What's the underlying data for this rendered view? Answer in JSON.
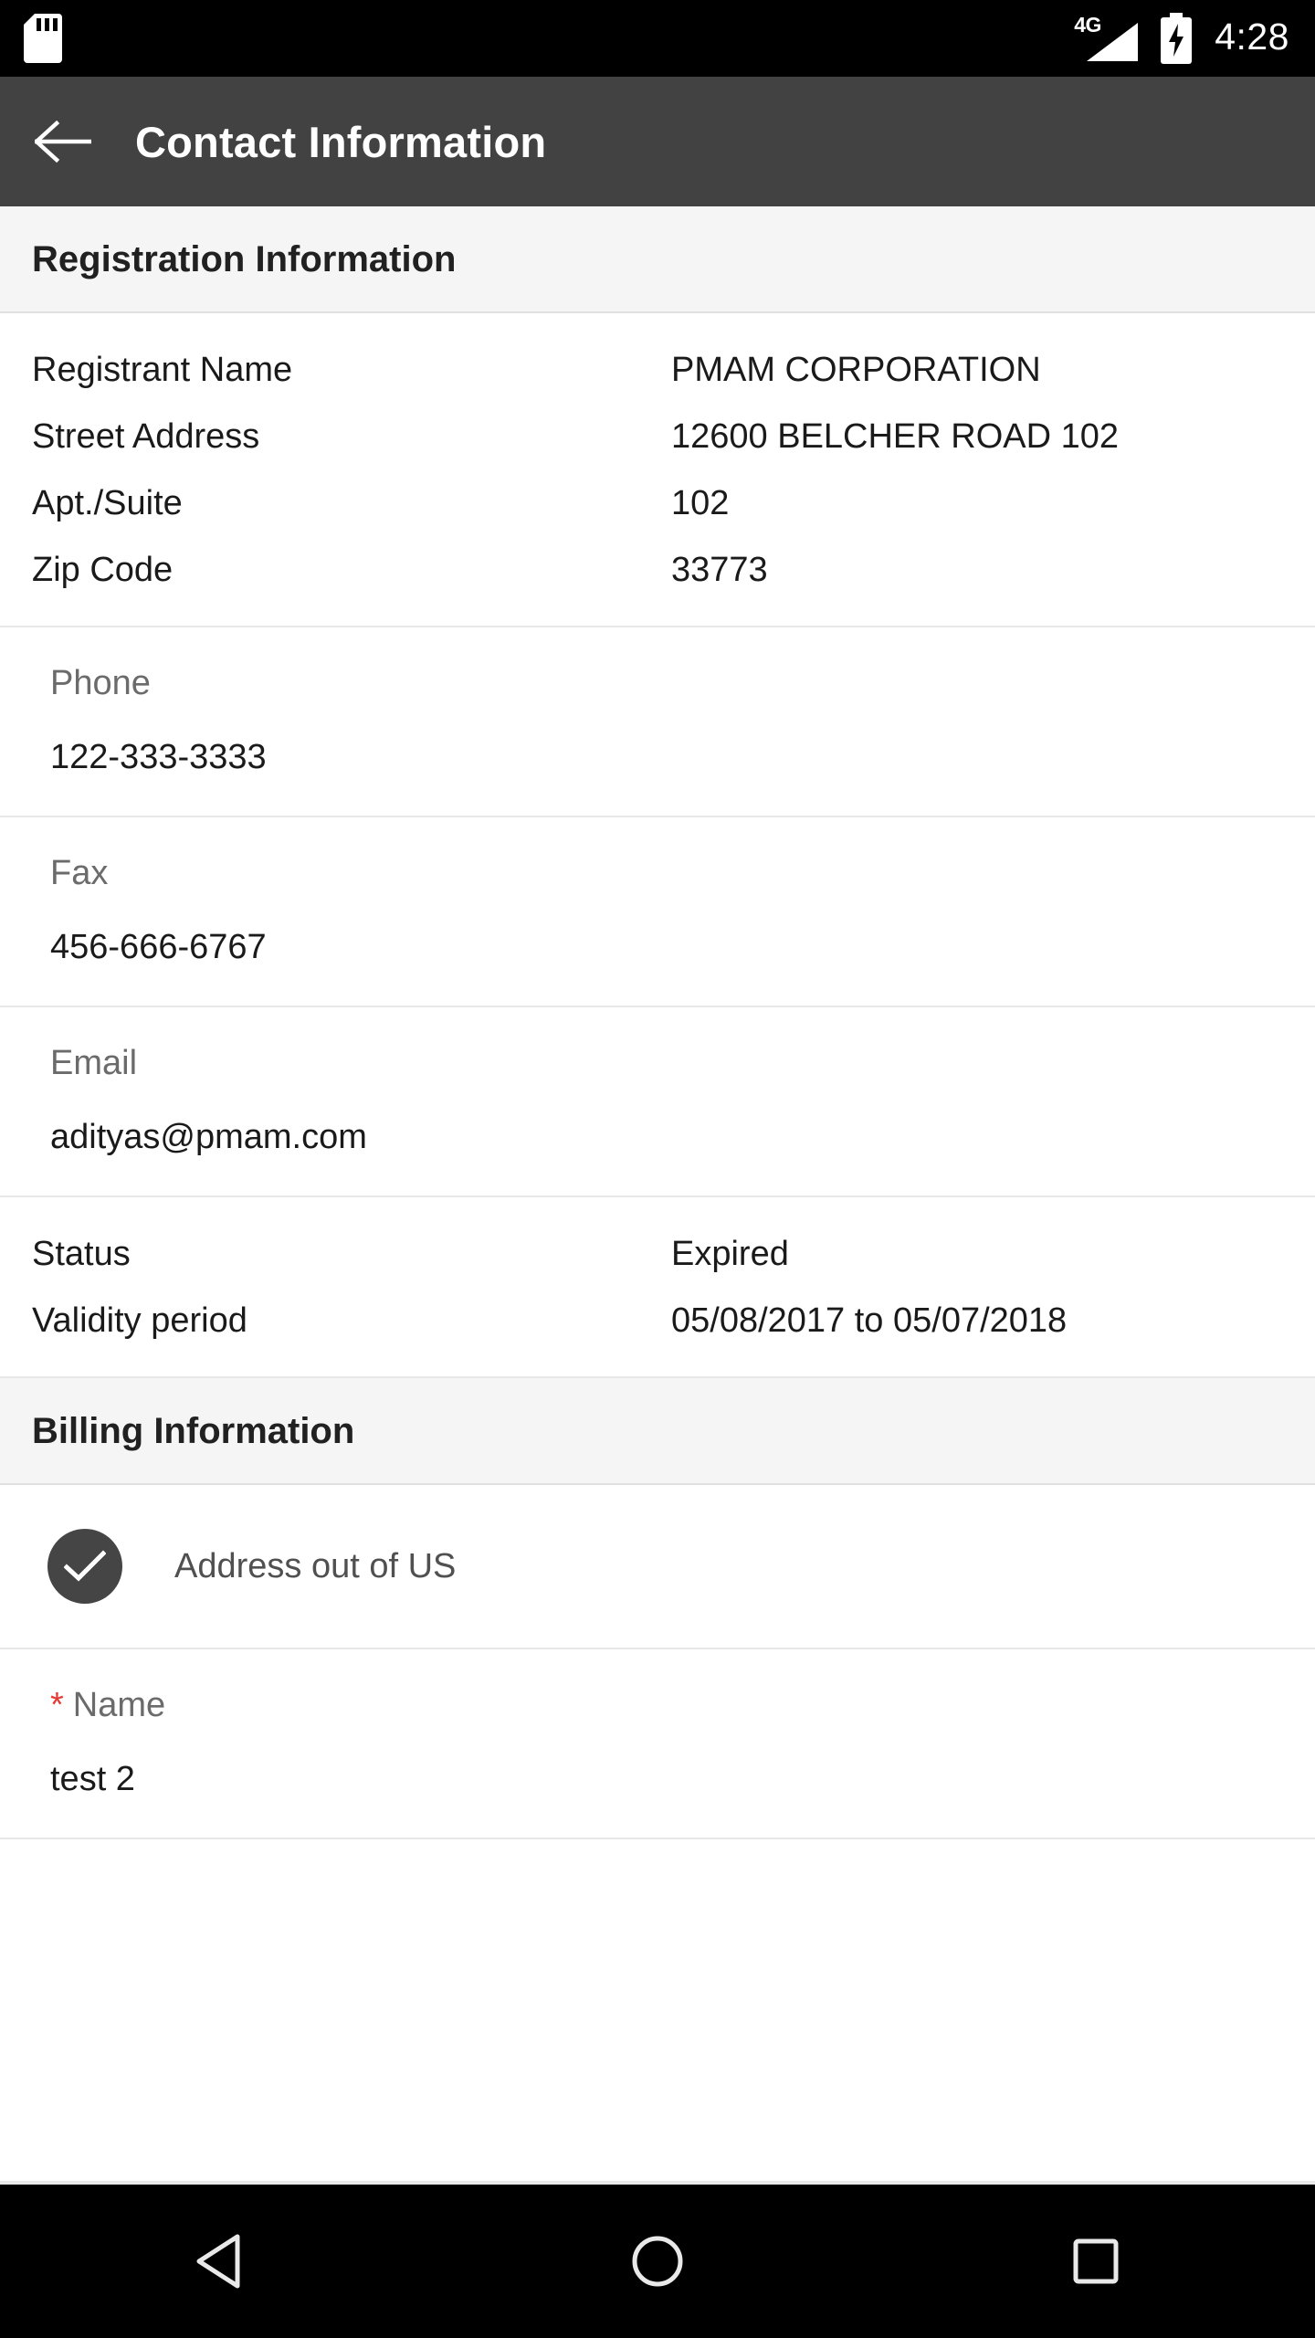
{
  "status_bar": {
    "sd_icon": "sd-card-icon",
    "network_label": "4G",
    "signal_icon": "signal-bars-icon",
    "battery_icon": "battery-charging-icon",
    "time": "4:28"
  },
  "app_bar": {
    "back_icon": "back-arrow-icon",
    "title": "Contact Information"
  },
  "sections": {
    "registration": {
      "header": "Registration Information",
      "rows": [
        {
          "label": "Registrant Name",
          "value": "PMAM CORPORATION"
        },
        {
          "label": "Street Address",
          "value": "12600 BELCHER ROAD 102"
        },
        {
          "label": "Apt./Suite",
          "value": "102"
        },
        {
          "label": "Zip Code",
          "value": "33773"
        }
      ],
      "phone": {
        "label": "Phone",
        "value": "122-333-3333"
      },
      "fax": {
        "label": "Fax",
        "value": "456-666-6767"
      },
      "email": {
        "label": "Email",
        "value": "adityas@pmam.com"
      },
      "status_rows": [
        {
          "label": "Status",
          "value": "Expired"
        },
        {
          "label": "Validity period",
          "value": "05/08/2017 to 05/07/2018"
        }
      ]
    },
    "billing": {
      "header": "Billing Information",
      "checkbox": {
        "label": "Address out of US",
        "checked": true,
        "icon": "check-icon",
        "color": "#454545"
      },
      "name_field": {
        "required_marker": "*",
        "label": "Name",
        "value": "test 2",
        "required_color": "#e53935"
      }
    }
  },
  "nav_bar": {
    "back": "back-triangle-icon",
    "home": "home-circle-icon",
    "recents": "recents-square-icon"
  }
}
